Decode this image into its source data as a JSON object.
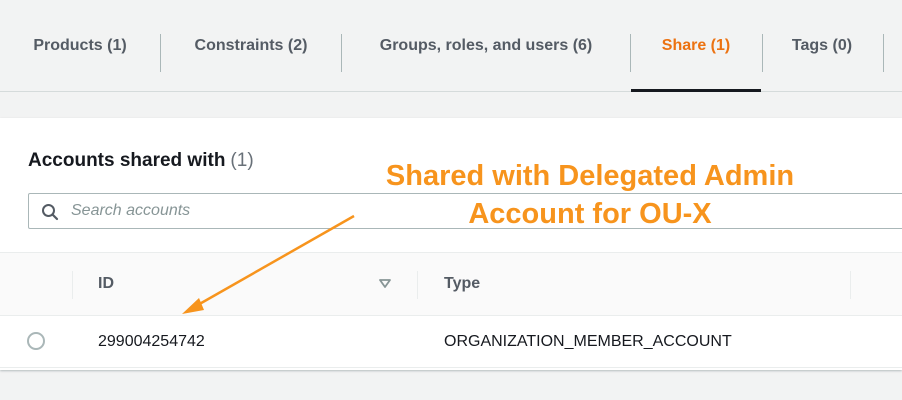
{
  "tabs": [
    {
      "label": "Products (1)",
      "active": false
    },
    {
      "label": "Constraints (2)",
      "active": false
    },
    {
      "label": "Groups, roles, and users (6)",
      "active": false
    },
    {
      "label": "Share (1)",
      "active": true
    },
    {
      "label": "Tags (0)",
      "active": false
    }
  ],
  "panel": {
    "title": "Accounts shared with",
    "count": "(1)"
  },
  "search": {
    "placeholder": "Search accounts",
    "value": "",
    "icon": "search-icon"
  },
  "table": {
    "columns": [
      {
        "label": "ID",
        "sortable": true
      },
      {
        "label": "Type",
        "sortable": false
      }
    ],
    "rows": [
      {
        "id": "299004254742",
        "type": "ORGANIZATION_MEMBER_ACCOUNT",
        "selected": false
      }
    ]
  },
  "annotation": {
    "line1": "Shared with Delegated Admin",
    "line2": "Account for OU-X"
  },
  "colors": {
    "active_tab": "#ec7211",
    "annotation": "#f7941d",
    "text": "#16191f",
    "muted": "#545b64"
  }
}
